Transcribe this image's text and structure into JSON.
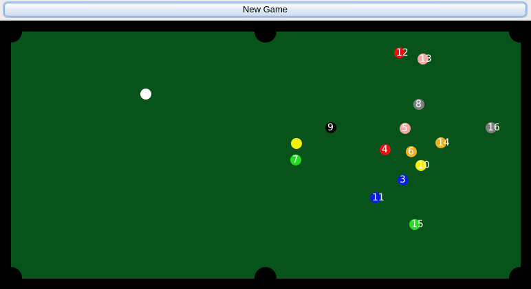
{
  "toolbar": {
    "new_game_label": "New Game"
  },
  "balls": [
    {
      "id": "cue",
      "label": "",
      "color": "#ffffff"
    },
    {
      "id": "ball-12",
      "label": "12",
      "color": "#e51010"
    },
    {
      "id": "ball-13",
      "label": "13",
      "color": "#f4a8a8"
    },
    {
      "id": "ball-8",
      "label": "8",
      "color": "#808080"
    },
    {
      "id": "ball-9",
      "label": "9",
      "color": "#000000"
    },
    {
      "id": "ball-5",
      "label": "5",
      "color": "#f4a8a8"
    },
    {
      "id": "ball-16",
      "label": "16",
      "color": "#808080"
    },
    {
      "id": "ball-14",
      "label": "14",
      "color": "#f0b020"
    },
    {
      "id": "ball-yellow",
      "label": "",
      "color": "#f4ee10"
    },
    {
      "id": "ball-4",
      "label": "4",
      "color": "#e51010"
    },
    {
      "id": "ball-6",
      "label": "6",
      "color": "#f0b020"
    },
    {
      "id": "ball-7",
      "label": "7",
      "color": "#22dd22"
    },
    {
      "id": "ball-10",
      "label": "10",
      "color": "#f4ee10"
    },
    {
      "id": "ball-3",
      "label": "3",
      "color": "#0a1ee0"
    },
    {
      "id": "ball-11",
      "label": "11",
      "color": "#0a1ee0"
    },
    {
      "id": "ball-15",
      "label": "15",
      "color": "#22dd22"
    }
  ]
}
